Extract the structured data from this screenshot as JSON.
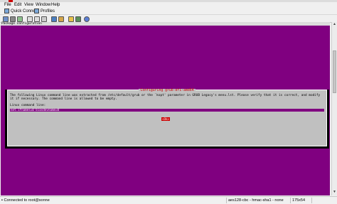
{
  "menu": [
    "File",
    "Edit",
    "View",
    "Window",
    "Help"
  ],
  "quickbar": {
    "quick_connect": "Quick Connect",
    "profiles": "Profiles"
  },
  "terminal": {
    "package_line": "Package configuration",
    "dialog_title": "Configuring grub-efi-amd64",
    "line1": "The following Linux command line was extracted from /etc/default/grub or the `kopt' parameter in GRUB Legacy's menu.lst. Please verify that it is correct, and modify",
    "line2": "it if necessary. The command line is allowed to be empty.",
    "label": "Linux command line:",
    "input_value": "net.ifnames=0 biosdevname=0",
    "ok_label": "<Ok>"
  },
  "status": {
    "connected": "Connected to root@sonne",
    "cipher": "aes128-cbc - hmac-sha1 - none",
    "size": "175x54"
  },
  "colors": {
    "terminal_bg": "#800080",
    "dialog_bg": "#c0c0c0",
    "accent": "#cc0000"
  }
}
